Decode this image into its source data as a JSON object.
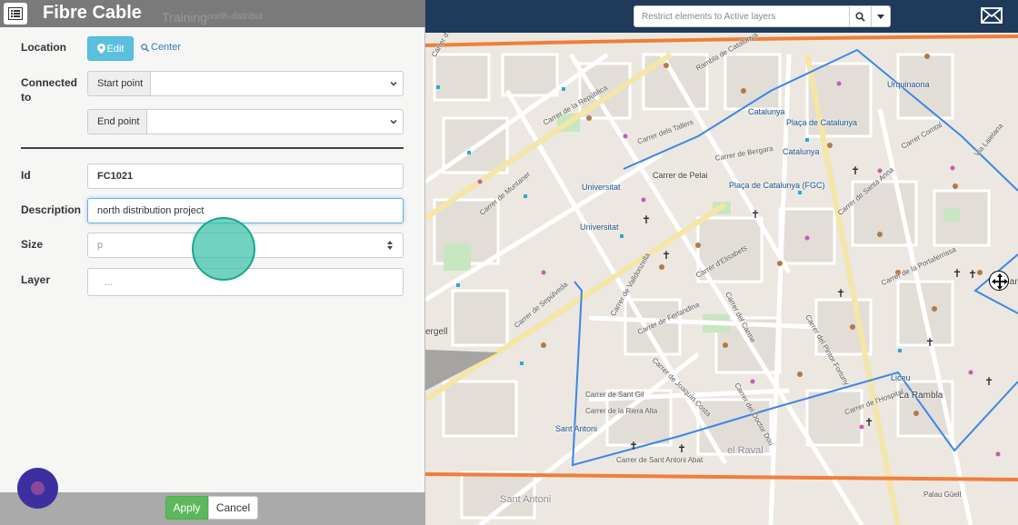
{
  "panel": {
    "title": "Fibre Cable",
    "ghost_tabs": [
      "Training",
      "north-distribut"
    ],
    "location": {
      "label": "Location",
      "edit_label": "Edit",
      "center_label": "Center"
    },
    "connected_to": {
      "label": "Connected to",
      "start_label": "Start point",
      "end_label": "End point",
      "start_value": "",
      "end_value": ""
    },
    "id": {
      "label": "Id",
      "value": "FC1021"
    },
    "description": {
      "label": "Description",
      "value": "north distribution project"
    },
    "size": {
      "label": "Size",
      "placeholder": "p"
    },
    "layer": {
      "label": "Layer",
      "placeholder": "..."
    },
    "footer": {
      "apply_label": "Apply",
      "cancel_label": "Cancel"
    }
  },
  "toolbar": {
    "search_placeholder": "Restrict elements to Active layers",
    "icons": [
      "search-icon",
      "caret-down-icon",
      "mail-icon"
    ]
  },
  "map": {
    "labels": {
      "trafalgar": "Carrer de Trafalgar",
      "urquinaona": "Urquinaona",
      "catalunya1": "Catalunya",
      "placa_cat": "Plaça de Catalunya",
      "catalunya2": "Catalunya",
      "catalunya_fgc": "Plaça de Catalunya (FGC)",
      "universitat1": "Universitat",
      "universitat2": "Universitat",
      "pelai": "Carrer de Pelai",
      "sant_antoni1": "Sant Antoni",
      "sant_antoni2": "Sant Antoni",
      "raval": "el Raval",
      "liceu": "Liceu",
      "la_rambla": "La Rambla",
      "palau_guell": "Palau Güell",
      "aribau": "Carrer d'Aribau",
      "muntaner": "Carrer de Muntaner",
      "sepulveda": "Carrer de Sepúlveda",
      "carme": "Carrer del Carme",
      "hospital": "Carrer de l'Hospital",
      "sant_gil": "Carrer de Sant Gil",
      "riera_alta": "Carrer de la Riera Alta",
      "valldonzella": "Carrer de Valldonzella",
      "tallers": "Carrer dels Tallers",
      "bergara": "Carrer de Bergara",
      "via_laietana": "Via Laietana",
      "comtal": "Carrer Comtal",
      "santa_anna": "Carrer de Santa Anna",
      "portaferrissa": "Carrer de la Portaferrissa",
      "pintor_fortuny": "Carrer del Pintor Fortuny",
      "ferlandina": "Carrer de Ferlandina",
      "joaquin_costa": "Carrer de Joaquín Costa",
      "elisabets": "Carrer d'Elisabets",
      "doctor_dou": "Carrer del Doctor Dou",
      "rambla_catalunya": "Rambla de Catalunya",
      "republica": "Carrer de la República",
      "sant_antoni_abat": "Carrer de Sant Antoni Abat",
      "ergell": "ergell",
      "bar": "Bar"
    }
  }
}
